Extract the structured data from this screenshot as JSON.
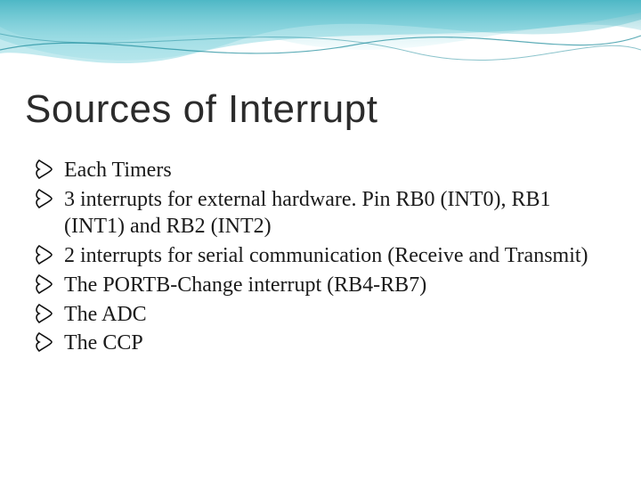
{
  "slide": {
    "title": "Sources of Interrupt",
    "bullets": [
      "Each Timers",
      "3 interrupts for external hardware. Pin RB0 (INT0), RB1 (INT1) and RB2 (INT2)",
      "2 interrupts for serial communication (Receive and Transmit)",
      "The PORTB-Change interrupt (RB4-RB7)",
      "The ADC",
      "The CCP"
    ]
  }
}
